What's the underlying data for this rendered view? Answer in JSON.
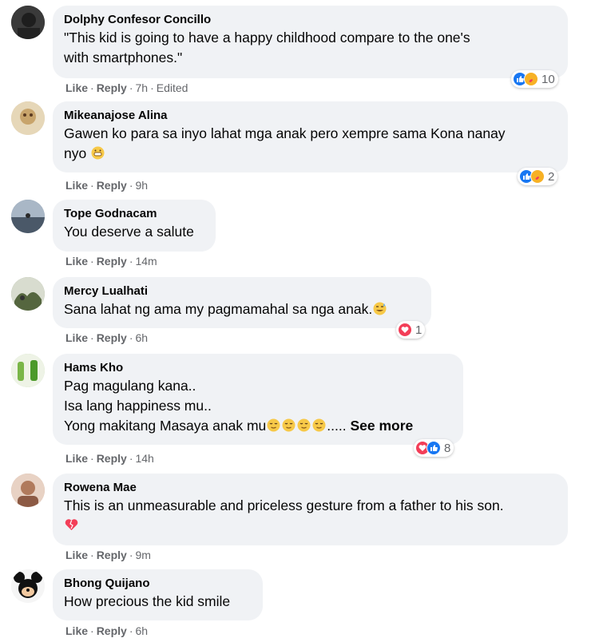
{
  "comments": [
    {
      "author": "Dolphy Confesor Concillo",
      "lines": [
        "\"This kid is going to have a happy childhood compare to the one's",
        "with smartphones.\""
      ],
      "actions": {
        "like": "Like",
        "reply": "Reply",
        "time": "7h",
        "edited": "Edited"
      },
      "reactions": {
        "icons": [
          "like-icon",
          "care-icon"
        ],
        "count": "10"
      }
    },
    {
      "author": "Mikeanajose Alina",
      "lines": [
        "Gawen ko para sa inyo lahat mga anak pero xempre sama Kona nanay",
        "nyo"
      ],
      "actions": {
        "like": "Like",
        "reply": "Reply",
        "time": "9h"
      },
      "reactions": {
        "icons": [
          "like-icon",
          "care-icon"
        ],
        "count": "2"
      }
    },
    {
      "author": "Tope Godnacam",
      "lines": [
        "You deserve a salute"
      ],
      "actions": {
        "like": "Like",
        "reply": "Reply",
        "time": "14m"
      }
    },
    {
      "author": "Mercy Lualhati",
      "lines": [
        "Sana lahat ng ama my pagmamahal sa nga anak."
      ],
      "actions": {
        "like": "Like",
        "reply": "Reply",
        "time": "6h"
      },
      "reactions": {
        "icons": [
          "love-icon"
        ],
        "count": "1"
      }
    },
    {
      "author": "Hams Kho",
      "lines": [
        "Pag magulang kana..",
        "Isa lang happiness mu..",
        "Yong makitang Masaya anak mu"
      ],
      "ellipsis": ".....",
      "see_more": "See more",
      "actions": {
        "like": "Like",
        "reply": "Reply",
        "time": "14h"
      },
      "reactions": {
        "icons": [
          "love-icon",
          "like-icon"
        ],
        "count": "8"
      }
    },
    {
      "author": "Rowena Mae",
      "lines": [
        "This is an unmeasurable and priceless gesture from a father to his son."
      ],
      "actions": {
        "like": "Like",
        "reply": "Reply",
        "time": "9m"
      }
    },
    {
      "author": "Bhong Quijano",
      "lines": [
        "How precious the kid smile"
      ],
      "actions": {
        "like": "Like",
        "reply": "Reply",
        "time": "6h"
      }
    }
  ],
  "colors": {
    "bubble": "#f0f2f5",
    "meta_text": "#65676b",
    "like_blue": "#1877f2",
    "love_red": "#f33e58",
    "care_yellow": "#f7b125"
  }
}
